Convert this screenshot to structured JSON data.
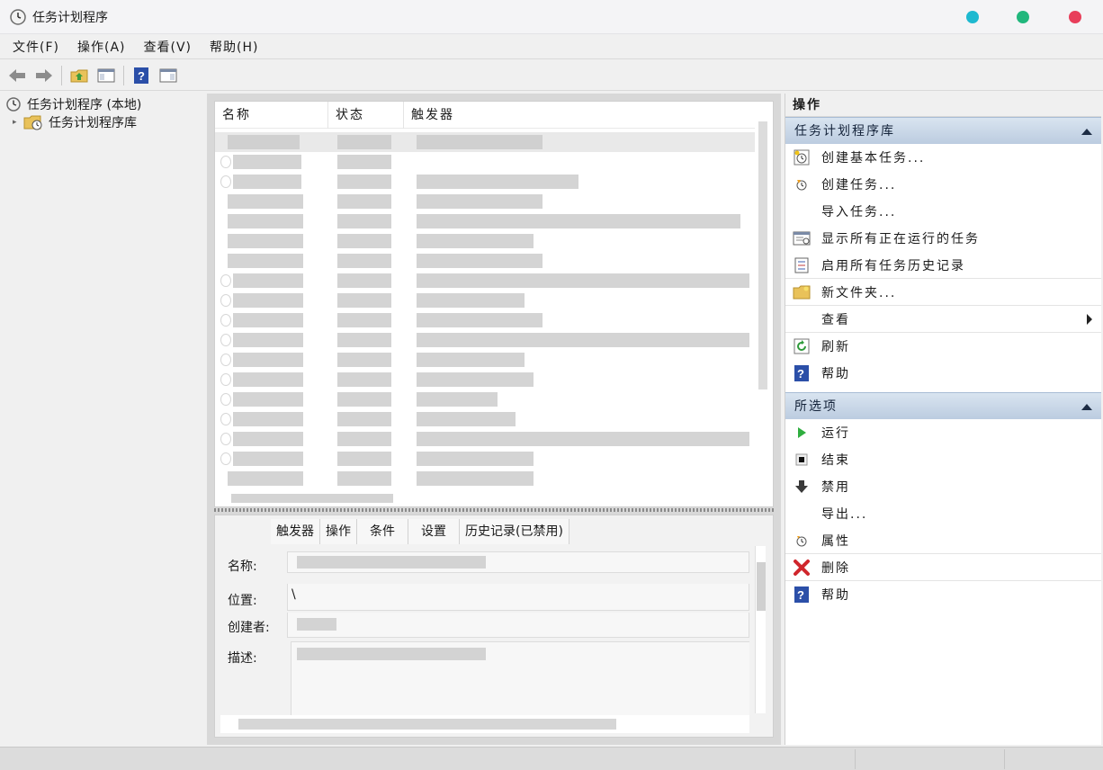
{
  "window": {
    "title": "任务计划程序",
    "icon": "clock-icon",
    "controls": [
      {
        "name": "minimize",
        "color": "#1eb9d0"
      },
      {
        "name": "maximize",
        "color": "#21b77c"
      },
      {
        "name": "close",
        "color": "#e83e5a"
      }
    ]
  },
  "menubar": {
    "items": [
      "文件(F)",
      "操作(A)",
      "查看(V)",
      "帮助(H)"
    ]
  },
  "toolbar": {
    "buttons": [
      "back-arrow-icon",
      "forward-arrow-icon",
      "folder-up-icon",
      "console-tree-icon",
      "help-icon",
      "action-pane-icon"
    ]
  },
  "tree": {
    "root_label": "任务计划程序 (本地)",
    "child_label": "任务计划程序库"
  },
  "task_list": {
    "columns": [
      "名称",
      "状态",
      "触发器"
    ]
  },
  "details": {
    "tabs": [
      "触发器",
      "操作",
      "条件",
      "设置",
      "历史记录(已禁用)"
    ],
    "fields": {
      "name_label": "名称:",
      "location_label": "位置:",
      "location_value": "\\",
      "author_label": "创建者:",
      "description_label": "描述:"
    }
  },
  "actions": {
    "title": "操作",
    "section1": {
      "header": "任务计划程序库",
      "items": [
        {
          "label": "创建基本任务...",
          "icon": "create-basic-task-icon"
        },
        {
          "label": "创建任务...",
          "icon": "create-task-icon"
        },
        {
          "label": "导入任务...",
          "icon": ""
        },
        {
          "label": "显示所有正在运行的任务",
          "icon": "running-tasks-icon"
        },
        {
          "label": "启用所有任务历史记录",
          "icon": "history-icon"
        },
        {
          "label": "新文件夹...",
          "icon": "new-folder-icon"
        },
        {
          "label": "查看",
          "icon": ""
        },
        {
          "label": "刷新",
          "icon": "refresh-icon"
        },
        {
          "label": "帮助",
          "icon": "help-icon"
        }
      ]
    },
    "section2": {
      "header": "所选项",
      "items": [
        {
          "label": "运行",
          "icon": "run-icon"
        },
        {
          "label": "结束",
          "icon": "stop-icon"
        },
        {
          "label": "禁用",
          "icon": "disable-icon"
        },
        {
          "label": "导出...",
          "icon": ""
        },
        {
          "label": "属性",
          "icon": "properties-icon"
        },
        {
          "label": "删除",
          "icon": "delete-icon"
        },
        {
          "label": "帮助",
          "icon": "help-icon"
        }
      ]
    }
  }
}
